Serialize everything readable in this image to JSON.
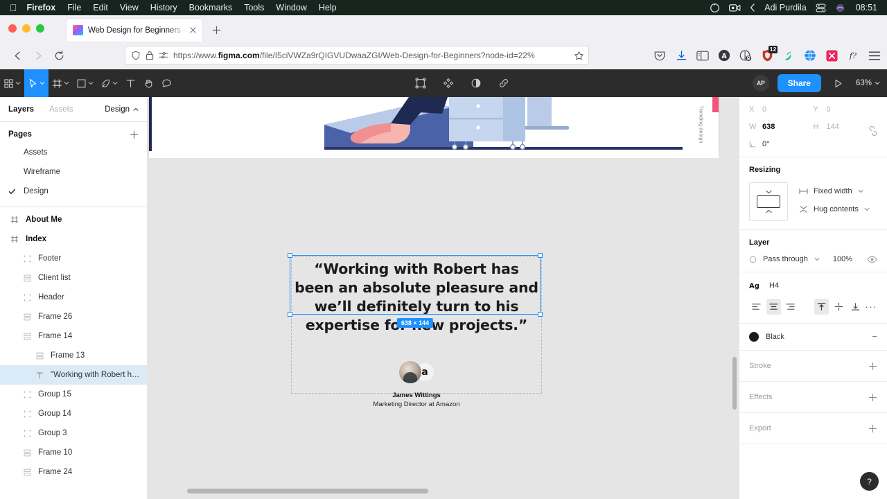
{
  "macbar": {
    "apple_icon": "apple-logo-icon",
    "menus": [
      "Firefox",
      "File",
      "Edit",
      "View",
      "History",
      "Bookmarks",
      "Tools",
      "Window",
      "Help"
    ],
    "right_icons": [
      "siri-icon",
      "screen-recording-icon",
      "chevron-left-icon",
      "control-center-icon",
      "wifi-icon"
    ],
    "user": "Adi Purdila",
    "clock": "08:51"
  },
  "browser": {
    "tab": {
      "title": "Web Design for Beginners – Figm",
      "favicon": "figma-favicon",
      "close_icon": "close-icon"
    },
    "new_tab_icon": "plus-icon",
    "nav": {
      "back_icon": "back-arrow-icon",
      "forward_icon": "forward-arrow-icon",
      "reload_icon": "reload-icon"
    },
    "url": {
      "prefix": "https://www.",
      "domain": "figma.com",
      "path": "/file/I5ciVWZa9rQIGVUDwaaZGI/Web-Design-for-Beginners?node-id=22%",
      "shield_icon": "shield-icon",
      "lock_icon": "lock-icon",
      "permissions_icon": "permissions-icon",
      "bookmark_icon": "star-icon"
    },
    "extensions": [
      {
        "name": "pocket-icon",
        "badge": ""
      },
      {
        "name": "downloads-icon",
        "badge": ""
      },
      {
        "name": "sidebar-icon",
        "badge": ""
      },
      {
        "name": "account-icon",
        "badge": ""
      },
      {
        "name": "privacy-badger-icon",
        "badge": ""
      },
      {
        "name": "ublock-origin-icon",
        "badge": "12"
      },
      {
        "name": "grammarly-icon",
        "badge": ""
      },
      {
        "name": "globe-extension-icon",
        "badge": ""
      },
      {
        "name": "screenshot-extension-icon",
        "badge": ""
      },
      {
        "name": "fontsninja-icon",
        "badge": ""
      },
      {
        "name": "app-menu-icon",
        "badge": ""
      }
    ]
  },
  "figma_toolbar": {
    "tools": [
      {
        "name": "main-menu-icon",
        "label": "",
        "has_chevron": true,
        "active": false
      },
      {
        "name": "move-tool-icon",
        "label": "",
        "has_chevron": true,
        "active": true
      },
      {
        "name": "frame-tool-icon",
        "label": "",
        "has_chevron": true,
        "active": false
      },
      {
        "name": "shape-tool-icon",
        "label": "",
        "has_chevron": true,
        "active": false
      },
      {
        "name": "pen-tool-icon",
        "label": "",
        "has_chevron": true,
        "active": false
      },
      {
        "name": "text-tool-icon",
        "label": "",
        "has_chevron": false,
        "active": false
      },
      {
        "name": "hand-tool-icon",
        "label": "",
        "has_chevron": false,
        "active": false
      },
      {
        "name": "comment-tool-icon",
        "label": "",
        "has_chevron": false,
        "active": false
      }
    ],
    "center_icons": [
      "scale-frame-icon",
      "component-icon",
      "mask-icon",
      "link-icon"
    ],
    "avatar": "AP",
    "share_label": "Share",
    "present_icon": "present-play-icon",
    "zoom_level": "63%"
  },
  "left_panel": {
    "tabs": {
      "layers": "Layers",
      "assets": "Assets",
      "design": "Design"
    },
    "pages_header": "Pages",
    "add_page_icon": "plus-icon",
    "pages": [
      {
        "label": "Assets",
        "active": false
      },
      {
        "label": "Wireframe",
        "active": false
      },
      {
        "label": "Design",
        "active": true
      }
    ],
    "layers": [
      {
        "label": "About Me",
        "icon": "frame-hash-icon",
        "indent": 0,
        "bold": true,
        "selected": false
      },
      {
        "label": "Index",
        "icon": "frame-hash-icon",
        "indent": 0,
        "bold": true,
        "selected": false
      },
      {
        "label": "Footer",
        "icon": "group-icon",
        "indent": 1,
        "bold": false,
        "selected": false
      },
      {
        "label": "Client list",
        "icon": "autolayout-icon",
        "indent": 1,
        "bold": false,
        "selected": false
      },
      {
        "label": "Header",
        "icon": "group-icon",
        "indent": 1,
        "bold": false,
        "selected": false
      },
      {
        "label": "Frame 26",
        "icon": "autolayout-icon",
        "indent": 1,
        "bold": false,
        "selected": false
      },
      {
        "label": "Frame 14",
        "icon": "autolayout-icon",
        "indent": 1,
        "bold": false,
        "selected": false
      },
      {
        "label": "Frame 13",
        "icon": "autolayout-icon",
        "indent": 2,
        "bold": false,
        "selected": false
      },
      {
        "label": "\"Working with Robert has...",
        "icon": "text-layer-icon",
        "indent": 2,
        "bold": false,
        "selected": true
      },
      {
        "label": "Group 15",
        "icon": "group-icon",
        "indent": 1,
        "bold": false,
        "selected": false
      },
      {
        "label": "Group 14",
        "icon": "group-icon",
        "indent": 1,
        "bold": false,
        "selected": false
      },
      {
        "label": "Group 3",
        "icon": "group-icon",
        "indent": 1,
        "bold": false,
        "selected": false
      },
      {
        "label": "Frame 10",
        "icon": "autolayout-icon",
        "indent": 1,
        "bold": false,
        "selected": false
      },
      {
        "label": "Frame 24",
        "icon": "autolayout-icon",
        "indent": 1,
        "bold": false,
        "selected": false
      }
    ]
  },
  "canvas": {
    "quote": "“Working with Robert has been an absolute pleasure and we’ll definitely turn to his expertise for new projects.”",
    "dimension_badge": "638 × 144",
    "author_name": "James Wittings",
    "author_role": "Marketing Director at Amazon",
    "amazon_glyph": "a",
    "vertical_strip_text": "Trending design",
    "selection_color": "#1e90ff"
  },
  "right_panel": {
    "position": {
      "x_label": "X",
      "x_value": "0",
      "y_label": "Y",
      "y_value": "0",
      "w_label": "W",
      "w_value": "638",
      "h_label": "H",
      "h_value": "144",
      "rotation_label": "rotation-icon",
      "rotation_value": "0°",
      "link_icon": "constrain-proportions-icon"
    },
    "resizing": {
      "title": "Resizing",
      "horizontal": "Fixed width",
      "vertical": "Hug contents"
    },
    "layer": {
      "title": "Layer",
      "blend_mode": "Pass through",
      "opacity": "100%",
      "visibility_icon": "eye-icon"
    },
    "text_style": {
      "icon_label": "Ag",
      "name": "H4",
      "align_icons": [
        "align-left-icon",
        "align-center-icon",
        "align-right-icon"
      ],
      "align_active_index": 1,
      "valign_icons": [
        "align-top-icon",
        "align-middle-icon",
        "align-bottom-icon"
      ],
      "valign_active_index": 0,
      "more_label": "···"
    },
    "fill": {
      "name": "Black",
      "color": "#1b1b1b",
      "remove_label": "−"
    },
    "sections": [
      {
        "title": "Stroke",
        "add_icon": "plus-icon"
      },
      {
        "title": "Effects",
        "add_icon": "plus-icon"
      },
      {
        "title": "Export",
        "add_icon": "plus-icon"
      }
    ],
    "help_label": "?"
  }
}
